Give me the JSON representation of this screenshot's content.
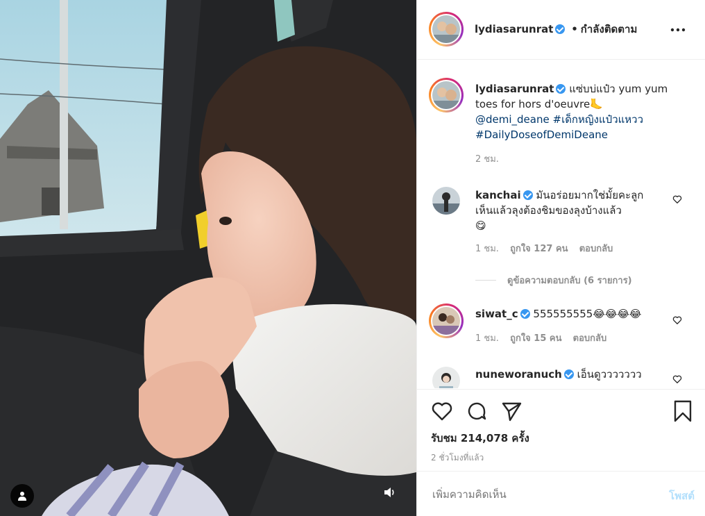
{
  "header": {
    "username": "lydiasarunrat",
    "separator": "•",
    "follow_status": "กำลังติดตาม",
    "more_icon": "more-horizontal-icon"
  },
  "caption": {
    "username": "lydiasarunrat",
    "text": "แซ่บบ่แป๋ว yum yum",
    "text_line2": "toes for hors d'oeuvre",
    "emoji": "🦶",
    "mention": "@demi_deane",
    "hashtag1": "#เด็กหญิงแป๋วแหวว",
    "hashtag2": "#DailyDoseofDemiDeane",
    "time": "2 ชม."
  },
  "comments": [
    {
      "username": "kanchai",
      "text_line1": "มันอร่อยมากใช่มั้ยคะลูก",
      "text_line2": "เห็นแล้วลุงต้องชิมของลุงบ้างแล้ว",
      "emoji": "😋",
      "time": "1 ชม.",
      "likes": "ถูกใจ 127 คน",
      "reply": "ตอบกลับ",
      "view_replies": "ดูข้อความตอบกลับ (6 รายการ)"
    },
    {
      "username": "siwat_c",
      "text": "555555555",
      "emoji": "😂😂😂😂",
      "time": "1 ชม.",
      "likes": "ถูกใจ 15 คน",
      "reply": "ตอบกลับ"
    },
    {
      "username": "nuneworanuch",
      "text": "เอ็นดูววววววว"
    }
  ],
  "actions": {
    "views": "รับชม 214,078 ครั้ง",
    "timestamp": "2 ชั่วโมงที่แล้ว"
  },
  "add_comment": {
    "placeholder": "เพิ่มความคิดเห็น",
    "post_label": "โพสต์"
  },
  "colors": {
    "verified": "#3897f0",
    "link": "#00376b",
    "muted": "#8e8e8e",
    "post_disabled": "#b2dffc"
  }
}
